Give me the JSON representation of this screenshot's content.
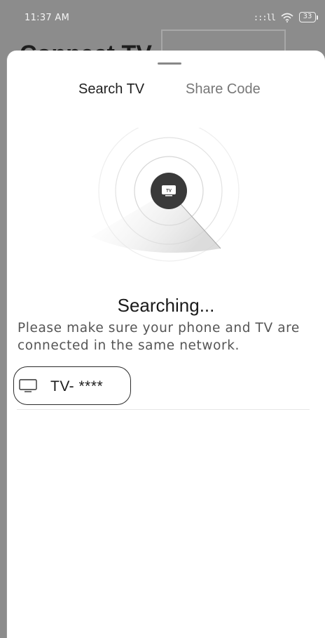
{
  "status_bar": {
    "time": "11:37 AM",
    "signal": ":::ll",
    "wifi_icon": "wifi-icon",
    "battery": "33"
  },
  "backdrop": {
    "title": "Connect TV"
  },
  "sheet": {
    "tabs": [
      {
        "label": "Search TV",
        "active": true
      },
      {
        "label": "Share Code",
        "active": false
      }
    ],
    "radar": {
      "center_label": "TV",
      "icon": "tv-icon"
    },
    "status_text": "Searching...",
    "hint": "Please make sure your phone and TV are connected in the same network.",
    "devices": [
      {
        "name": "TV- ****",
        "icon": "monitor-icon"
      }
    ]
  },
  "colors": {
    "backdrop": "#8c8c8c",
    "sheet": "#ffffff",
    "active_tab": "#1f1f1f",
    "inactive_tab": "#777777",
    "radar_center": "#3a3a3a"
  }
}
